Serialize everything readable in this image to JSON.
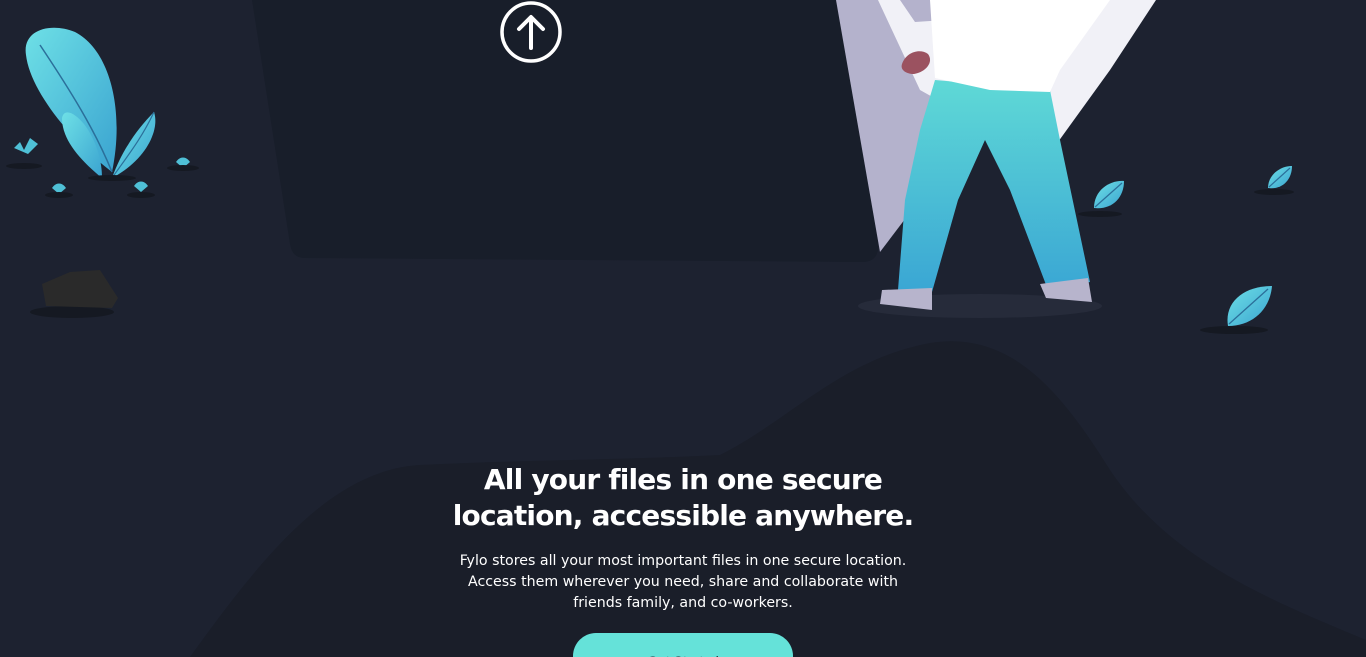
{
  "hero": {
    "headline_line1": "All your files in one secure",
    "headline_line2": "location, accessible anywhere.",
    "subtext_line1": "Fylo stores all your most important files in one secure location.",
    "subtext_line2": "Access them wherever you need, share and collaborate with",
    "subtext_line3": "friends family, and co-workers.",
    "cta_label": "Get Started"
  },
  "colors": {
    "background": "#1d2230",
    "panel": "#181e2a",
    "accent": "#65e2d9",
    "leaf": "#4fc0d6"
  },
  "icons": [
    "upload-arrow-icon",
    "plant-icon",
    "leaf-icon",
    "rock-icon",
    "person-carrying-folder-illustration"
  ]
}
